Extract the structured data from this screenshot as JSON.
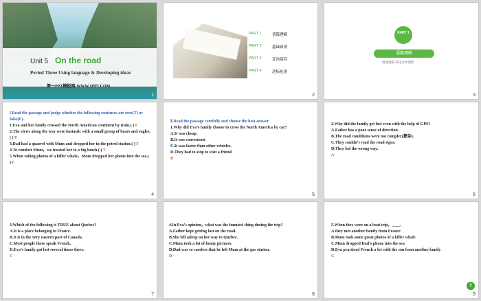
{
  "slides": [
    {
      "number": "1",
      "unit": "Unit 5",
      "title": "On the road",
      "period": "Period Three      Using language & Developing ideas",
      "site": "第一PPT模板网-WWW.1PPT.COM"
    },
    {
      "number": "2",
      "menu": [
        {
          "part": "PART 1",
          "text": "语篇理解"
        },
        {
          "part": "PART 2",
          "text": "基础自测"
        },
        {
          "part": "PART 3",
          "text": "互动探究"
        },
        {
          "part": "PART 4",
          "text": "达标检测"
        }
      ]
    },
    {
      "number": "3",
      "circle_label": "PART 1",
      "bar_label": "语篇理解",
      "subtitle": "增进理解    深化文本理解"
    },
    {
      "number": "4",
      "heading": "Ⅰ.Read the passage and judge whether the following sentences are true(T) or false(F).",
      "items": [
        "1.Eva and her family crossed the North American continent by train.(   )",
        "2.The views along the way were fantastic with a small group of bears and eagles.(   )",
        "3.Dad had a quarrel with Mum and dropped her in the petrol station.(   )",
        "4.To comfort Mum，we treated her to a big lunch.(   )",
        "5.When taking photos of a killer whale，Mum dropped her phone into the sea.(   )"
      ],
      "marks": [
        "F",
        "T",
        "F",
        "T",
        "F"
      ]
    },
    {
      "number": "5",
      "heading": "Ⅱ.Read the passage carefully and choose the best answer.",
      "question": "1.Why did Eva’s family choose to cross the North America by car?",
      "options": [
        "A.It was cheap.",
        "B.It was convenient.",
        "C.It was faster than other vehicles.",
        "D.They had to stop to visit a friend."
      ],
      "answer": "B"
    },
    {
      "number": "6",
      "question": "2.Why did the family get lost even with the help of GPS?",
      "options": [
        "A.Father has a poor sense of direction.",
        "B.The road conditions were too complex(复杂).",
        "C.They couldn’t read the road signs.",
        "D.They led the wrong way."
      ],
      "answer": "A"
    },
    {
      "number": "7",
      "question": "3.Which of the following is TRUE about Quebec?",
      "options": [
        "A.It is a place belonging to France.",
        "B.It is in the very eastern part of Canada.",
        "C.Most people there speak French.",
        "D.Eva’s family got lost several times there."
      ],
      "answer": "C"
    },
    {
      "number": "8",
      "question": "4.In Eva’s opinion，what was the funniest thing during the trip?",
      "options": [
        "A.Father kept getting lost on the road.",
        "B.She fell asleep on her way to Quebec.",
        "C.Mum took a lot of funny pictures.",
        "D.Dad was so careless that he left Mum at the gas station."
      ],
      "answer": "D"
    },
    {
      "number": "9",
      "question": "5.When they were on a boat trip，____.",
      "options": [
        "A.they met another family from France",
        "B.Mum took some great photos of a killer whale",
        "C.Mum dropped Dad’s phone into the sea",
        "D.Eva practiced French a lot with the son from another family"
      ],
      "answer": "C",
      "badge": "9"
    }
  ]
}
